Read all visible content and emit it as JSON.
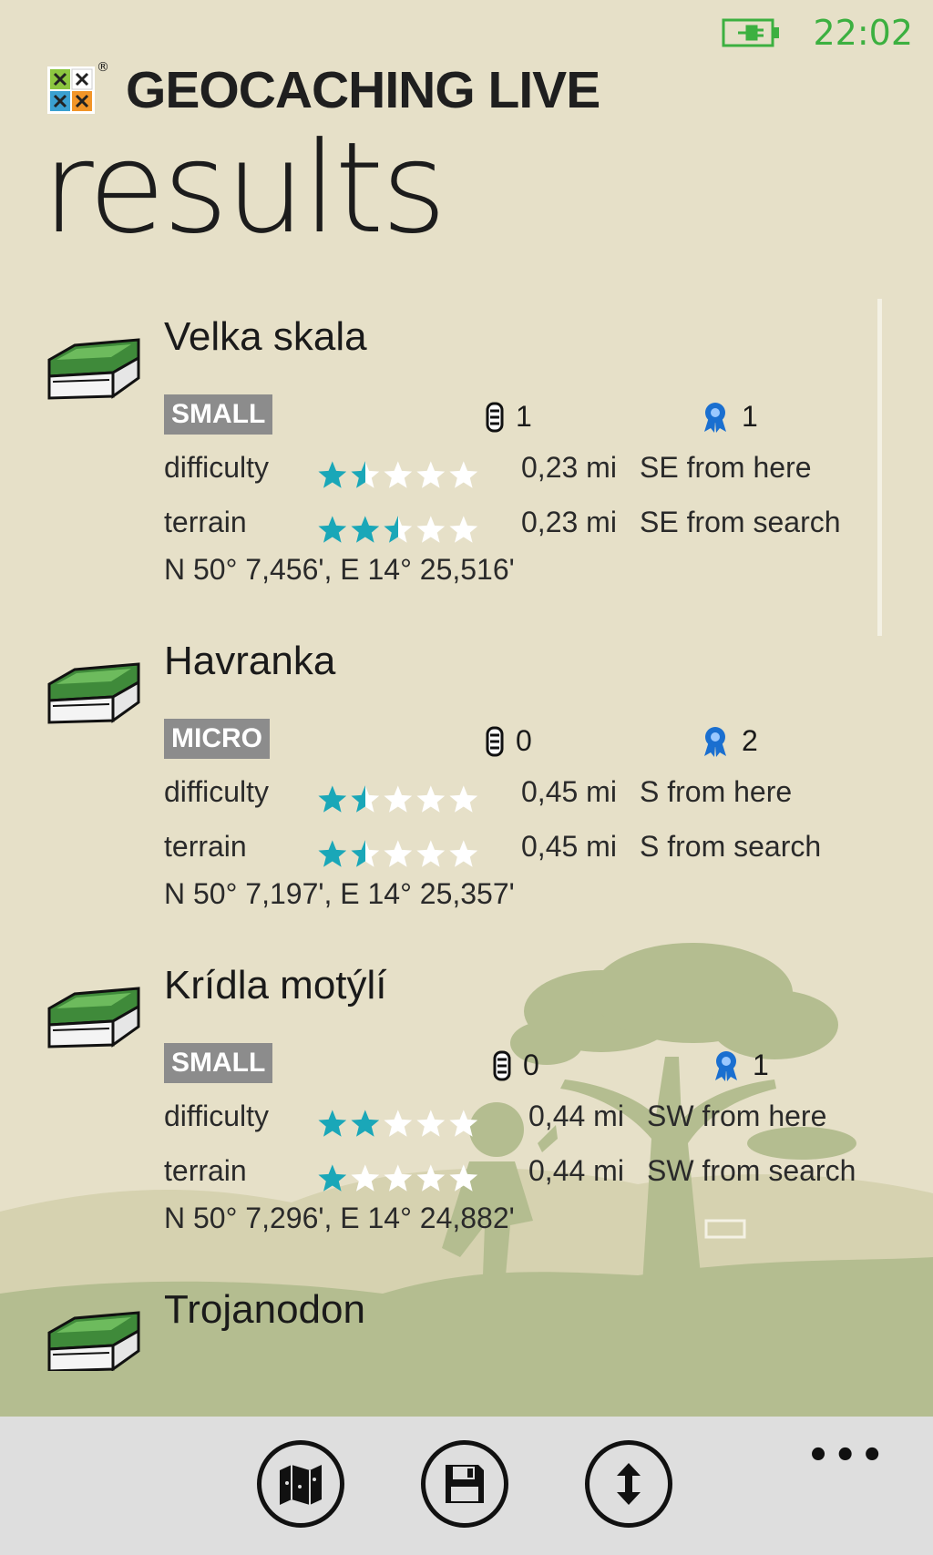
{
  "status": {
    "time": "22:02",
    "battery_icon": "battery-charging-icon"
  },
  "header": {
    "app_title": "GEOCACHING LIVE",
    "registered_mark": "®",
    "page_title": "results"
  },
  "labels": {
    "difficulty": "difficulty",
    "terrain": "terrain"
  },
  "colors": {
    "accent": "#3cb040",
    "star": "#1aa7b8",
    "badge": "#8c8c8c",
    "background": "#e6e0c8"
  },
  "results": [
    {
      "name": "Velka skala",
      "size": "SMALL",
      "trackables": "1",
      "favorites": "1",
      "difficulty": 1.5,
      "terrain": 2.5,
      "dist_here": "0,23 mi",
      "dir_here": "SE from here",
      "dist_search": "0,23 mi",
      "dir_search": "SE from search",
      "coords": "N 50° 7,456', E 14° 25,516'"
    },
    {
      "name": "Havranka",
      "size": "MICRO",
      "trackables": "0",
      "favorites": "2",
      "difficulty": 1.5,
      "terrain": 1.5,
      "dist_here": "0,45 mi",
      "dir_here": "S from here",
      "dist_search": "0,45 mi",
      "dir_search": "S from search",
      "coords": "N 50° 7,197', E 14° 25,357'"
    },
    {
      "name": "Krídla motýlí",
      "size": "SMALL",
      "trackables": "0",
      "favorites": "1",
      "difficulty": 2,
      "terrain": 1,
      "dist_here": "0,44 mi",
      "dir_here": "SW from here",
      "dist_search": "0,44 mi",
      "dir_search": "SW from search",
      "coords": "N 50° 7,296', E 14° 24,882'"
    },
    {
      "name": "Trojanodon"
    }
  ],
  "appbar": {
    "buttons": [
      "map-icon",
      "save-icon",
      "sort-icon"
    ],
    "more": "•••"
  }
}
